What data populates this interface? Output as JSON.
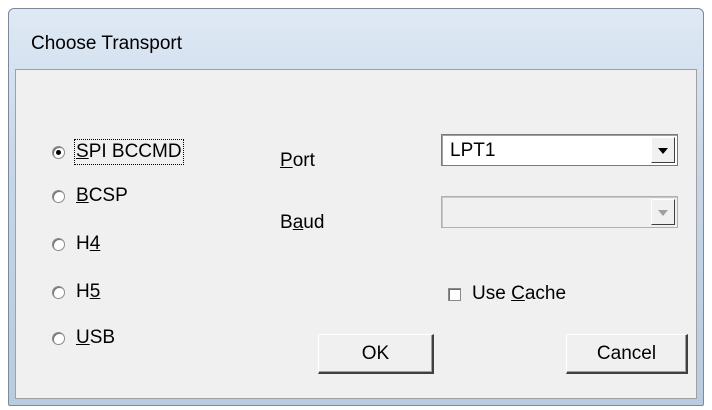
{
  "window": {
    "title": "Choose Transport"
  },
  "transport": {
    "options": [
      {
        "pre": "",
        "key": "S",
        "post": "PI BCCMD",
        "checked": true
      },
      {
        "pre": "",
        "key": "B",
        "post": "CSP",
        "checked": false
      },
      {
        "pre": "H",
        "key": "4",
        "post": "",
        "checked": false
      },
      {
        "pre": "H",
        "key": "5",
        "post": "",
        "checked": false
      },
      {
        "pre": "",
        "key": "U",
        "post": "SB",
        "checked": false
      }
    ]
  },
  "port": {
    "label_key": "P",
    "label_rest": "ort",
    "value": "LPT1"
  },
  "baud": {
    "label_pre": "B",
    "label_key": "a",
    "label_rest": "ud",
    "value": ""
  },
  "cache": {
    "label_pre": "Use ",
    "label_key": "C",
    "label_rest": "ache",
    "checked": false
  },
  "buttons": {
    "ok": "OK",
    "cancel": "Cancel"
  }
}
